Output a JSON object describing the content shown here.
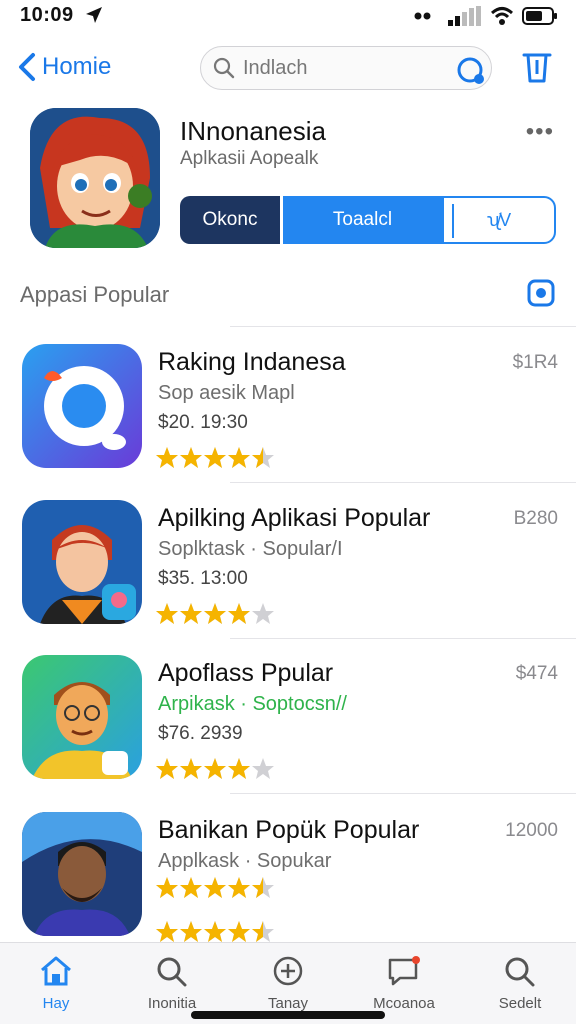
{
  "status_bar": {
    "time": "10:09"
  },
  "nav": {
    "back_label": "Homie",
    "search_value": "Indlach"
  },
  "hero": {
    "title": "INnonanesia",
    "subtitle": "Aplkasii Aopealk",
    "segments": [
      "Okonc",
      "Toaalcl",
      "ʯ̸V"
    ]
  },
  "section": {
    "title": "Appasi Popular"
  },
  "list": [
    {
      "title": "Raking Indanesa",
      "subtitle": "Sop aesik Mapl",
      "subtitle_green": false,
      "price_line": "$20. 19:30",
      "rating": 4.5,
      "price": "$1R4"
    },
    {
      "title": "Apilking Aplikasi Popular",
      "subtitle": "Soplktask · Sopular/I",
      "subtitle_green": false,
      "price_line": "$35. 13:00",
      "rating": 4,
      "price": "B280"
    },
    {
      "title": "Apoflass Ppular",
      "subtitle": "Arpikask · Soptocsn//",
      "subtitle_green": true,
      "price_line": "$76. 2939",
      "rating": 4,
      "price": "$474"
    },
    {
      "title": "Banikan Popük Popular",
      "subtitle": "Applkask · Sopukar",
      "subtitle_green": false,
      "price_line": "",
      "rating": 4.5,
      "price": "12000"
    }
  ],
  "tab_bar": [
    {
      "label": "Hay",
      "icon": "home-icon",
      "active": true
    },
    {
      "label": "Inonitia",
      "icon": "search-icon",
      "active": false
    },
    {
      "label": "Tanay",
      "icon": "add-circle-icon",
      "active": false
    },
    {
      "label": "Mcoanoa",
      "icon": "message-icon",
      "active": false
    },
    {
      "label": "Sedelt",
      "icon": "search-icon",
      "active": false
    }
  ],
  "colors": {
    "accent": "#2386f0",
    "dark_accent": "#1d3560",
    "star": "#f5b400",
    "green_text": "#2fb34b"
  }
}
